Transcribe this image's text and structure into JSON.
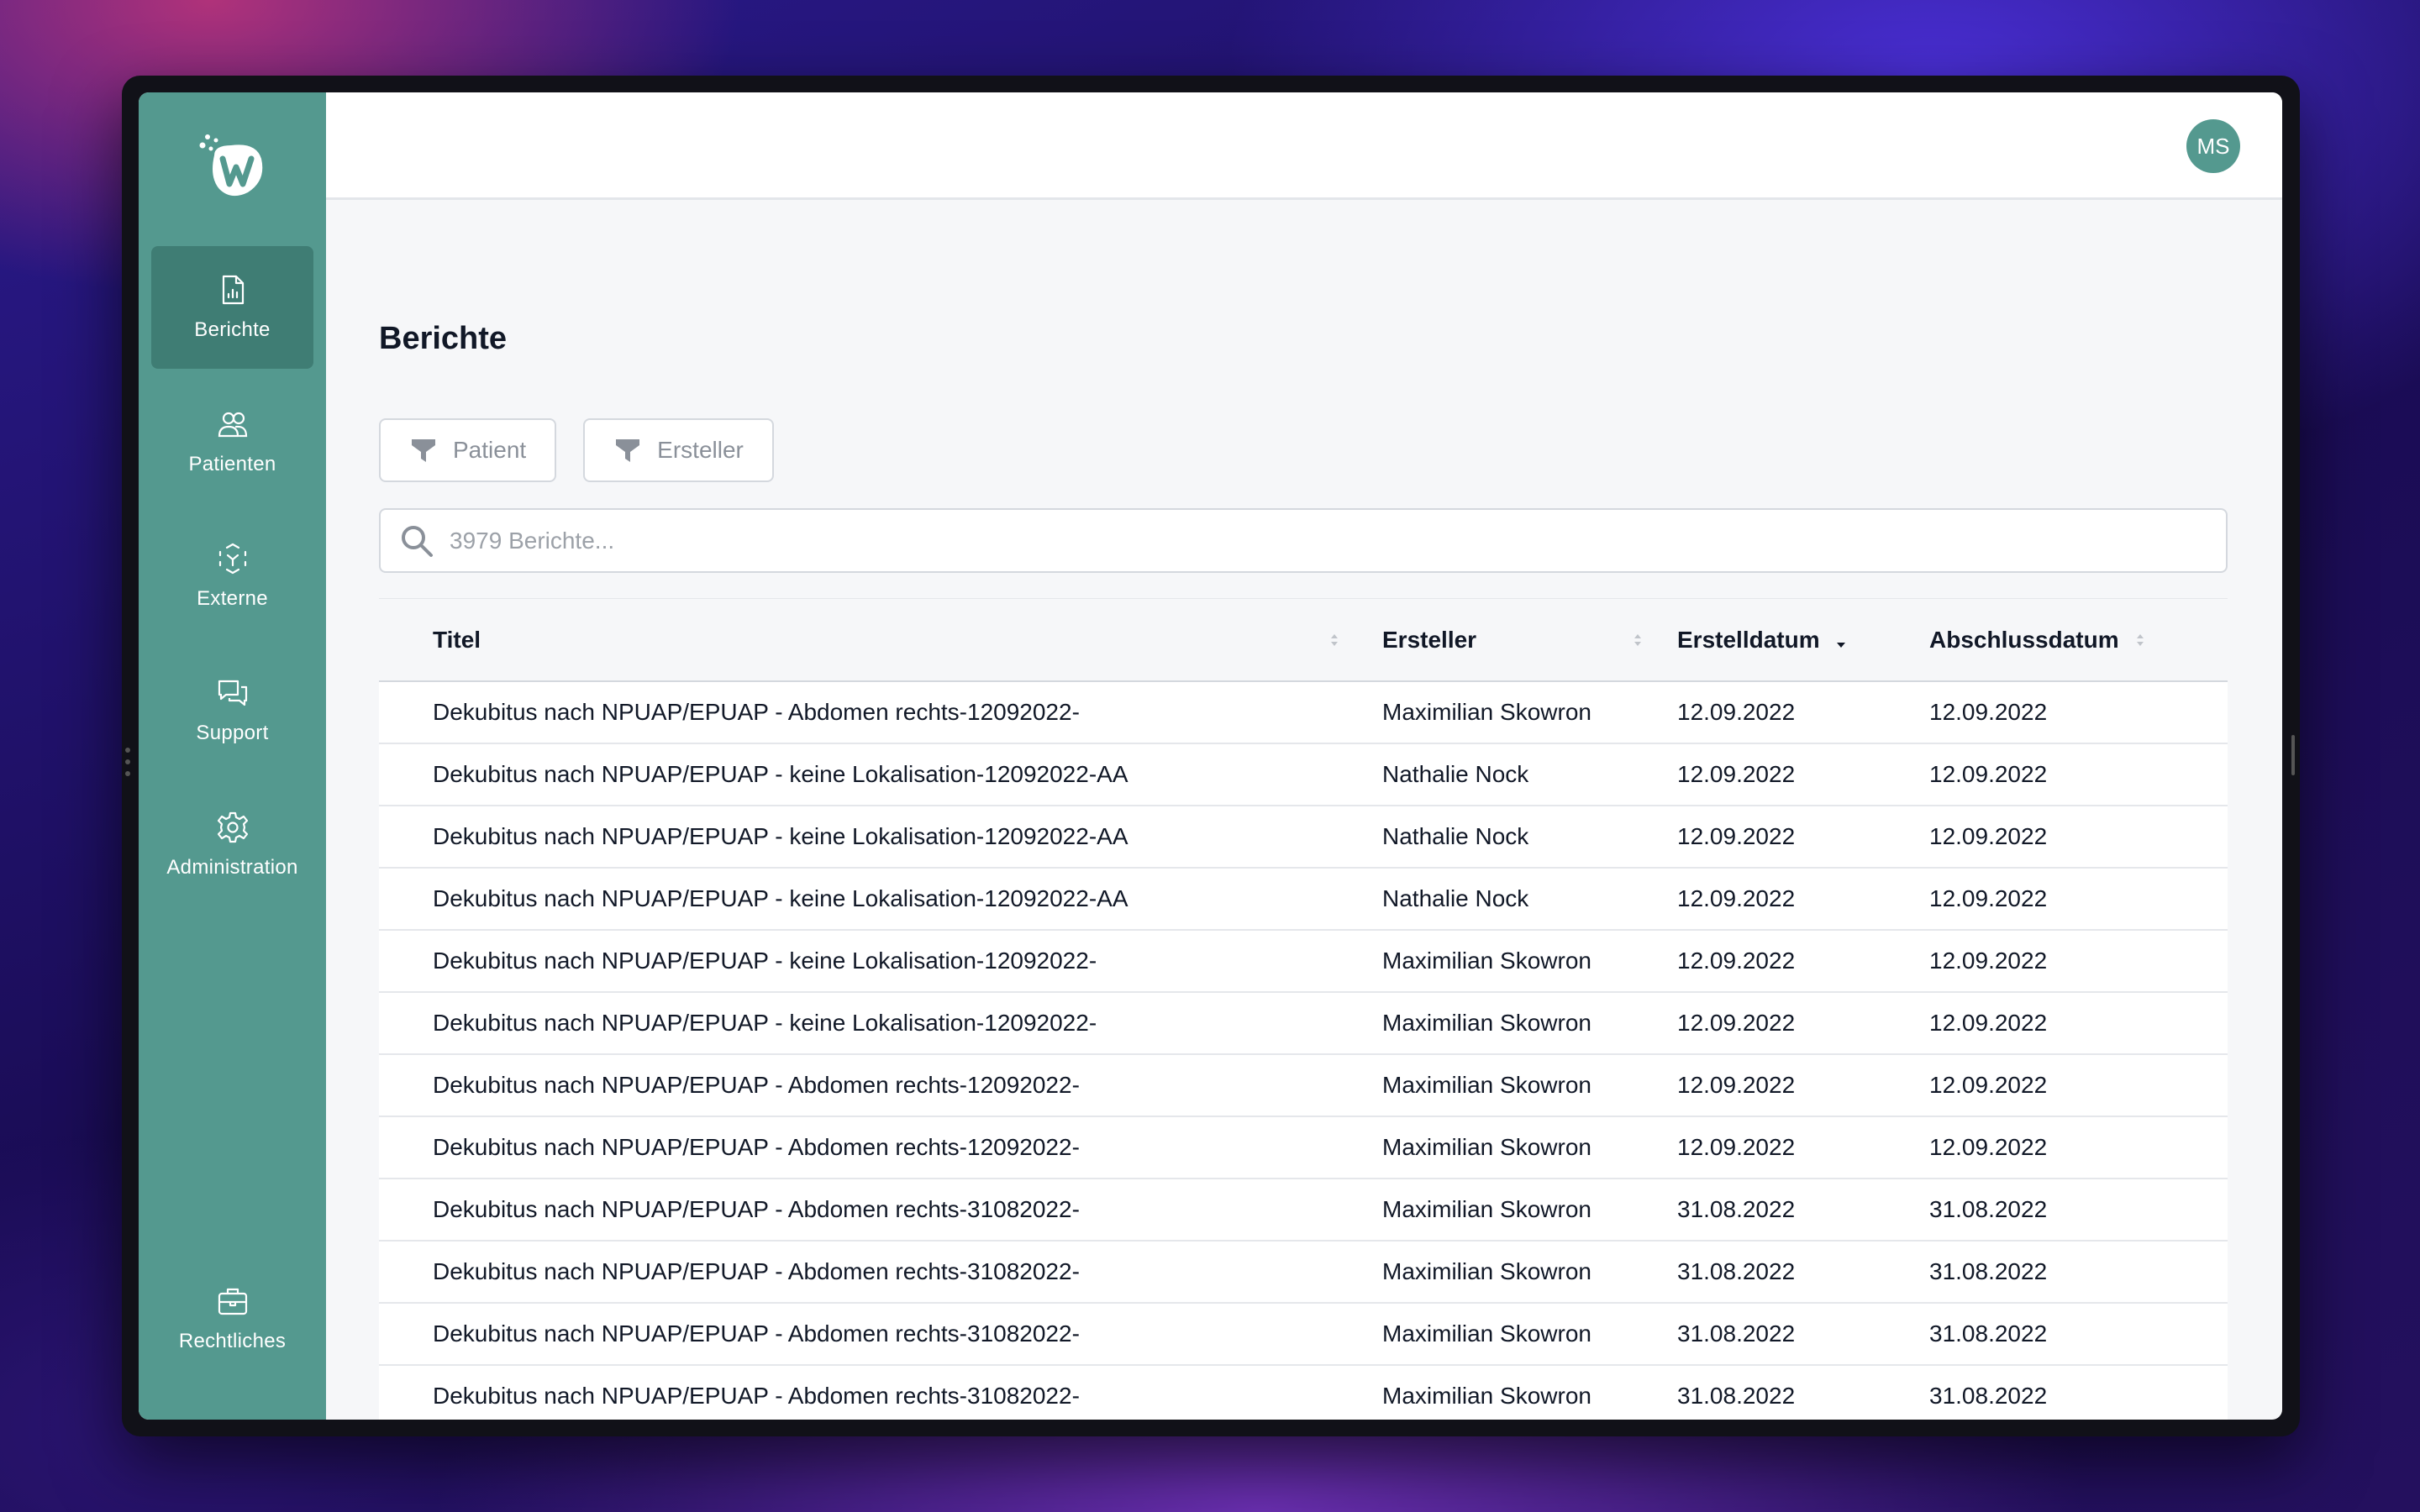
{
  "sidebar": {
    "items": [
      {
        "label": "Berichte",
        "icon": "report-icon",
        "active": true
      },
      {
        "label": "Patienten",
        "icon": "users-icon",
        "active": false
      },
      {
        "label": "Externe",
        "icon": "externe-icon",
        "active": false
      },
      {
        "label": "Support",
        "icon": "chat-icon",
        "active": false
      },
      {
        "label": "Administration",
        "icon": "gear-icon",
        "active": false
      }
    ],
    "bottom_item": {
      "label": "Rechtliches",
      "icon": "briefcase-icon"
    }
  },
  "header": {
    "avatar_initials": "MS"
  },
  "page": {
    "title": "Berichte"
  },
  "filters": {
    "patient": "Patient",
    "ersteller": "Ersteller"
  },
  "search": {
    "placeholder": "3979 Berichte..."
  },
  "table": {
    "columns": [
      "Titel",
      "Ersteller",
      "Erstelldatum",
      "Abschlussdatum"
    ],
    "sorted_column": "Erstelldatum",
    "rows": [
      [
        "Dekubitus nach NPUAP/EPUAP - Abdomen rechts-12092022-",
        "Maximilian Skowron",
        "12.09.2022",
        "12.09.2022"
      ],
      [
        "Dekubitus nach NPUAP/EPUAP - keine Lokalisation-12092022-AA",
        "Nathalie Nock",
        "12.09.2022",
        "12.09.2022"
      ],
      [
        "Dekubitus nach NPUAP/EPUAP - keine Lokalisation-12092022-AA",
        "Nathalie Nock",
        "12.09.2022",
        "12.09.2022"
      ],
      [
        "Dekubitus nach NPUAP/EPUAP - keine Lokalisation-12092022-AA",
        "Nathalie Nock",
        "12.09.2022",
        "12.09.2022"
      ],
      [
        "Dekubitus nach NPUAP/EPUAP - keine Lokalisation-12092022-",
        "Maximilian Skowron",
        "12.09.2022",
        "12.09.2022"
      ],
      [
        "Dekubitus nach NPUAP/EPUAP - keine Lokalisation-12092022-",
        "Maximilian Skowron",
        "12.09.2022",
        "12.09.2022"
      ],
      [
        "Dekubitus nach NPUAP/EPUAP - Abdomen rechts-12092022-",
        "Maximilian Skowron",
        "12.09.2022",
        "12.09.2022"
      ],
      [
        "Dekubitus nach NPUAP/EPUAP - Abdomen rechts-12092022-",
        "Maximilian Skowron",
        "12.09.2022",
        "12.09.2022"
      ],
      [
        "Dekubitus nach NPUAP/EPUAP - Abdomen rechts-31082022-",
        "Maximilian Skowron",
        "31.08.2022",
        "31.08.2022"
      ],
      [
        "Dekubitus nach NPUAP/EPUAP - Abdomen rechts-31082022-",
        "Maximilian Skowron",
        "31.08.2022",
        "31.08.2022"
      ],
      [
        "Dekubitus nach NPUAP/EPUAP - Abdomen rechts-31082022-",
        "Maximilian Skowron",
        "31.08.2022",
        "31.08.2022"
      ],
      [
        "Dekubitus nach NPUAP/EPUAP - Abdomen rechts-31082022-",
        "Maximilian Skowron",
        "31.08.2022",
        "31.08.2022"
      ]
    ]
  },
  "colors": {
    "sidebar": "#54998f",
    "sidebar_active": "#3f7d74",
    "text": "#111827"
  }
}
